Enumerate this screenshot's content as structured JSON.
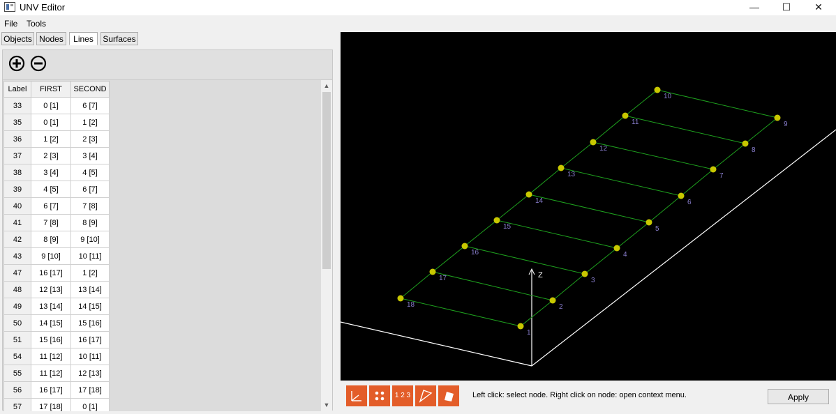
{
  "window": {
    "title": "UNV Editor",
    "minimize": "—",
    "maximize": "☐",
    "close": "✕"
  },
  "menu": {
    "file": "File",
    "tools": "Tools"
  },
  "tabs": [
    {
      "label": "Objects",
      "active": false
    },
    {
      "label": "Nodes",
      "active": false
    },
    {
      "label": "Lines",
      "active": true
    },
    {
      "label": "Surfaces",
      "active": false
    }
  ],
  "toolbar": {
    "add_icon": "plus-circle-icon",
    "remove_icon": "minus-circle-icon"
  },
  "table": {
    "headers": [
      "Label",
      "FIRST",
      "SECOND"
    ],
    "rows": [
      [
        "33",
        "0 [1]",
        "6 [7]"
      ],
      [
        "35",
        "0 [1]",
        "1 [2]"
      ],
      [
        "36",
        "1 [2]",
        "2 [3]"
      ],
      [
        "37",
        "2 [3]",
        "3 [4]"
      ],
      [
        "38",
        "3 [4]",
        "4 [5]"
      ],
      [
        "39",
        "4 [5]",
        "6 [7]"
      ],
      [
        "40",
        "6 [7]",
        "7 [8]"
      ],
      [
        "41",
        "7 [8]",
        "8 [9]"
      ],
      [
        "42",
        "8 [9]",
        "9 [10]"
      ],
      [
        "43",
        "9 [10]",
        "10 [11]"
      ],
      [
        "47",
        "16 [17]",
        "1 [2]"
      ],
      [
        "48",
        "12 [13]",
        "13 [14]"
      ],
      [
        "49",
        "13 [14]",
        "14 [15]"
      ],
      [
        "50",
        "14 [15]",
        "15 [16]"
      ],
      [
        "51",
        "15 [16]",
        "16 [17]"
      ],
      [
        "54",
        "11 [12]",
        "10 [11]"
      ],
      [
        "55",
        "11 [12]",
        "12 [13]"
      ],
      [
        "56",
        "16 [17]",
        "17 [18]"
      ],
      [
        "57",
        "17 [18]",
        "0 [1]"
      ]
    ]
  },
  "viewport": {
    "axis_label": "Z",
    "node_color": "#c8c800",
    "line_color": "#1ea01e",
    "node_labels": [
      "1",
      "2",
      "3",
      "4",
      "5",
      "6",
      "7",
      "8",
      "9",
      "10",
      "11",
      "12",
      "13",
      "14",
      "15",
      "16",
      "17",
      "18"
    ]
  },
  "bottom": {
    "buttons": [
      "axes-icon",
      "nodes-icon",
      "numbering-icon",
      "wireframe-icon",
      "surface-icon"
    ],
    "numbering_label": "1 2 3",
    "status": "Left click: select node. Right click on node: open context menu.",
    "apply": "Apply",
    "button_color": "#e35d29"
  }
}
